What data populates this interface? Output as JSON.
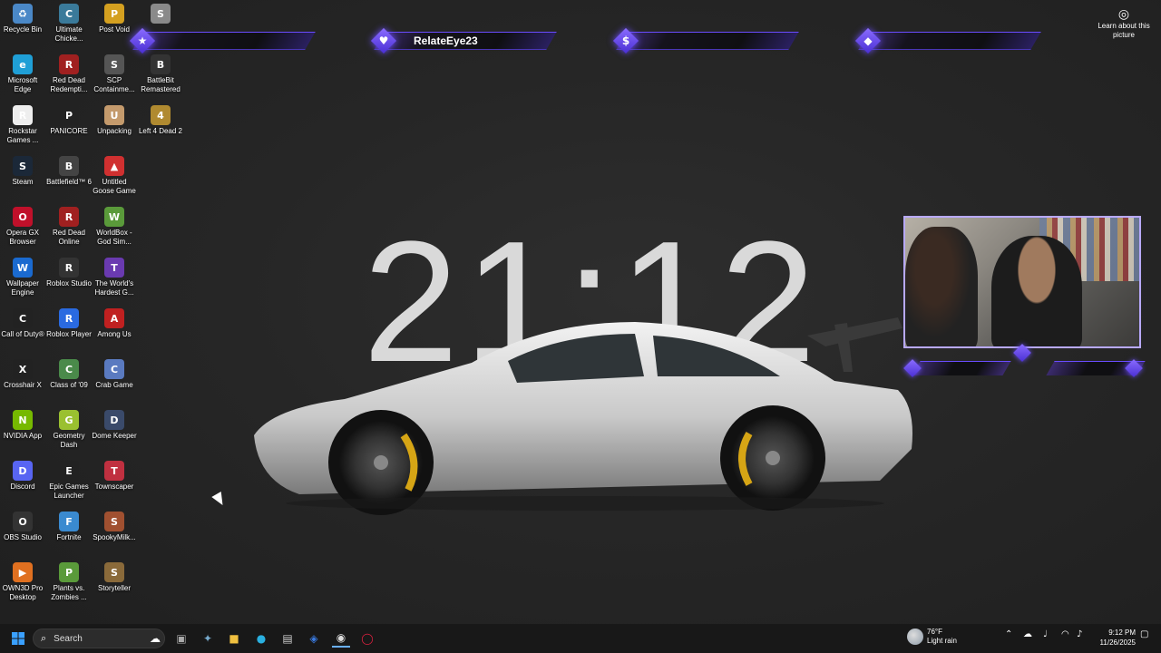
{
  "desktop": {
    "icons": [
      {
        "label": "Recycle Bin",
        "icon": "recycle-bin-icon",
        "color": "#4a88c7",
        "glyph": "♻"
      },
      {
        "label": "Ultimate Chicke...",
        "icon": "chicken-game-icon",
        "color": "#3a7a9a",
        "glyph": "C"
      },
      {
        "label": "Post Void",
        "icon": "post-void-icon",
        "color": "#d4a020",
        "glyph": "P"
      },
      {
        "label": "",
        "icon": "skate-game-icon",
        "color": "#8a8a8a",
        "glyph": "S"
      },
      {
        "label": "Microsoft Edge",
        "icon": "edge-icon",
        "color": "#1f9fd6",
        "glyph": "e"
      },
      {
        "label": "Red Dead Redempti...",
        "icon": "rdr-icon",
        "color": "#a02020",
        "glyph": "R"
      },
      {
        "label": "SCP Containme...",
        "icon": "scp-icon",
        "color": "#555555",
        "glyph": "S"
      },
      {
        "label": "BattleBit Remastered",
        "icon": "battlebit-icon",
        "color": "#333333",
        "glyph": "B"
      },
      {
        "label": "Rockstar Games ...",
        "icon": "rockstar-icon",
        "color": "#eeeeee",
        "glyph": "R"
      },
      {
        "label": "PANICORE",
        "icon": "panicore-icon",
        "color": "#222222",
        "glyph": "P"
      },
      {
        "label": "Unpacking",
        "icon": "unpacking-icon",
        "color": "#c49a6c",
        "glyph": "U"
      },
      {
        "label": "Left 4 Dead 2",
        "icon": "l4d2-icon",
        "color": "#b08a30",
        "glyph": "4"
      },
      {
        "label": "Steam",
        "icon": "steam-icon",
        "color": "#1b2838",
        "glyph": "S"
      },
      {
        "label": "Battlefield™ 6",
        "icon": "battlefield-icon",
        "color": "#444444",
        "glyph": "B"
      },
      {
        "label": "Untitled Goose Game",
        "icon": "goose-icon",
        "color": "#d03030",
        "glyph": "▲"
      },
      {
        "label": "",
        "icon": "empty-slot",
        "color": "transparent",
        "glyph": ""
      },
      {
        "label": "Opera GX Browser",
        "icon": "opera-gx-icon",
        "color": "#c0102a",
        "glyph": "O"
      },
      {
        "label": "Red Dead Online",
        "icon": "rdo-icon",
        "color": "#a02020",
        "glyph": "R"
      },
      {
        "label": "WorldBox - God Sim...",
        "icon": "worldbox-icon",
        "color": "#5a9a3a",
        "glyph": "W"
      },
      {
        "label": "",
        "icon": "empty-slot",
        "color": "transparent",
        "glyph": ""
      },
      {
        "label": "Wallpaper Engine",
        "icon": "wallpaper-engine-icon",
        "color": "#1a6ad0",
        "glyph": "W"
      },
      {
        "label": "Roblox Studio",
        "icon": "roblox-studio-icon",
        "color": "#333333",
        "glyph": "R"
      },
      {
        "label": "The World's Hardest G...",
        "icon": "worlds-hardest-icon",
        "color": "#6a3ab0",
        "glyph": "T"
      },
      {
        "label": "",
        "icon": "empty-slot",
        "color": "transparent",
        "glyph": ""
      },
      {
        "label": "Call of Duty®",
        "icon": "cod-icon",
        "color": "#222222",
        "glyph": "C"
      },
      {
        "label": "Roblox Player",
        "icon": "roblox-player-icon",
        "color": "#2a6ae0",
        "glyph": "R"
      },
      {
        "label": "Among Us",
        "icon": "among-us-icon",
        "color": "#c02020",
        "glyph": "A"
      },
      {
        "label": "",
        "icon": "empty-slot",
        "color": "transparent",
        "glyph": ""
      },
      {
        "label": "Crosshair X",
        "icon": "crosshair-icon",
        "color": "#222222",
        "glyph": "X"
      },
      {
        "label": "Class of '09",
        "icon": "class09-icon",
        "color": "#4a8a4a",
        "glyph": "C"
      },
      {
        "label": "Crab Game",
        "icon": "crab-game-icon",
        "color": "#5a7ac0",
        "glyph": "C"
      },
      {
        "label": "",
        "icon": "empty-slot",
        "color": "transparent",
        "glyph": ""
      },
      {
        "label": "NVIDIA App",
        "icon": "nvidia-icon",
        "color": "#76b900",
        "glyph": "N"
      },
      {
        "label": "Geometry Dash",
        "icon": "geometry-dash-icon",
        "color": "#9ac030",
        "glyph": "G"
      },
      {
        "label": "Dome Keeper",
        "icon": "dome-keeper-icon",
        "color": "#3a4a6a",
        "glyph": "D"
      },
      {
        "label": "",
        "icon": "empty-slot",
        "color": "transparent",
        "glyph": ""
      },
      {
        "label": "Discord",
        "icon": "discord-icon",
        "color": "#5865f2",
        "glyph": "D"
      },
      {
        "label": "Epic Games Launcher",
        "icon": "epic-icon",
        "color": "#222222",
        "glyph": "E"
      },
      {
        "label": "Townscaper",
        "icon": "townscaper-icon",
        "color": "#c03040",
        "glyph": "T"
      },
      {
        "label": "",
        "icon": "empty-slot",
        "color": "transparent",
        "glyph": ""
      },
      {
        "label": "OBS Studio",
        "icon": "obs-icon",
        "color": "#333333",
        "glyph": "O"
      },
      {
        "label": "Fortnite",
        "icon": "fortnite-icon",
        "color": "#3a8ad0",
        "glyph": "F"
      },
      {
        "label": "SpookyMilk...",
        "icon": "spooky-milk-icon",
        "color": "#a05030",
        "glyph": "S"
      },
      {
        "label": "",
        "icon": "empty-slot",
        "color": "transparent",
        "glyph": ""
      },
      {
        "label": "OWN3D Pro Desktop",
        "icon": "own3d-icon",
        "color": "#e07020",
        "glyph": "▶"
      },
      {
        "label": "Plants vs. Zombies ...",
        "icon": "pvz-icon",
        "color": "#5a9a3a",
        "glyph": "P"
      },
      {
        "label": "Storyteller",
        "icon": "storyteller-icon",
        "color": "#8a6a3a",
        "glyph": "S"
      }
    ]
  },
  "overlay": {
    "bars": [
      {
        "symbol": "★",
        "text": "",
        "icon": "star-icon"
      },
      {
        "symbol": "♥",
        "text": "RelateEye23",
        "icon": "heart-icon"
      },
      {
        "symbol": "$",
        "text": "",
        "icon": "dollar-icon"
      },
      {
        "symbol": "◆",
        "text": "",
        "icon": "diamond-icon"
      }
    ]
  },
  "wallpaper": {
    "clock": "21:12"
  },
  "learn": {
    "label": "Learn about this picture"
  },
  "taskbar": {
    "search_label": "Search",
    "weather_temp": "76°F",
    "weather_cond": "Light rain",
    "time": "9:12 PM",
    "date": "11/26/2025"
  }
}
